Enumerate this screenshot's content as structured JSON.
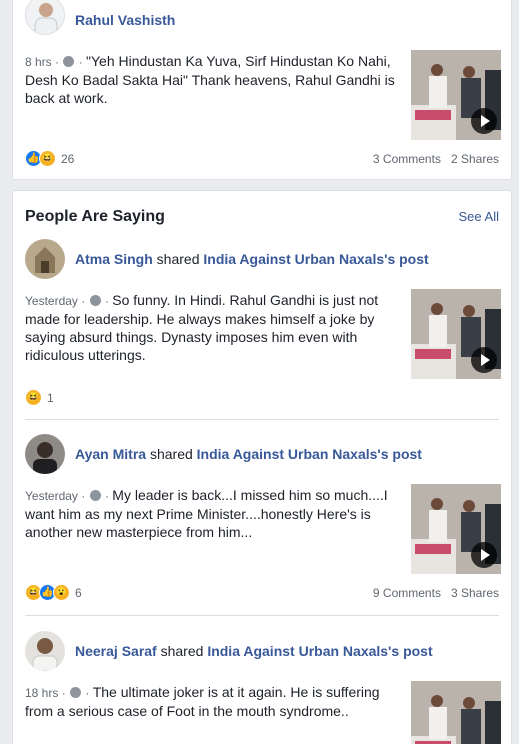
{
  "top_post": {
    "author": "Rahul Vashisth",
    "time": "8 hrs",
    "text": "\"Yeh Hindustan Ka Yuva, Sirf Hindustan Ko Nahi, Desh Ko Badal Sakta Hai\" Thank heavens, Rahul Gandhi is back at work.",
    "reaction_count": "26",
    "comments": "3 Comments",
    "shares": "2 Shares"
  },
  "section": {
    "title": "People Are Saying",
    "see_all": "See All"
  },
  "posts": [
    {
      "author": "Atma Singh",
      "shared_word": "shared",
      "page": "India Against Urban Naxals's post",
      "time": "Yesterday",
      "text": "So funny. In Hindi. Rahul Gandhi is just not made for leadership. He always makes himself a joke by saying absurd things. Dynasty imposes him even with ridiculous utterings.",
      "reaction_count": "1"
    },
    {
      "author": "Ayan Mitra",
      "shared_word": "shared",
      "page": "India Against Urban Naxals's post",
      "time": "Yesterday",
      "text": "My leader is back...I missed him so much....I want him as my next Prime Minister....honestly Here's is another new masterpiece from him...",
      "reaction_count": "6",
      "comments": "9 Comments",
      "shares": "3 Shares"
    },
    {
      "author": "Neeraj Saraf",
      "shared_word": "shared",
      "page": "India Against Urban Naxals's post",
      "time": "18 hrs",
      "text": "The ultimate joker is at it again. He is suffering from a serious case of Foot in the mouth syndrome.."
    }
  ],
  "colors": {
    "link": "#385898",
    "like": "#1877f2",
    "haha": "#f7b125",
    "background": "#e9ebee"
  }
}
